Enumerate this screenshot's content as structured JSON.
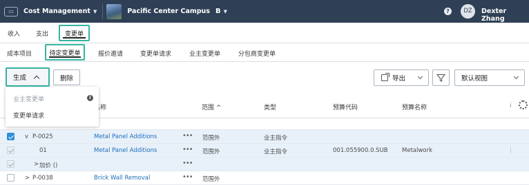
{
  "topbar": {
    "app_name": "Cost Management",
    "project_name": "Pacific Center Campus",
    "project_badge": "B",
    "help_label": "?",
    "user_initials": "DZ",
    "user_name": "Dexter Zhang"
  },
  "main_tabs": [
    {
      "label": "收入",
      "selected": false
    },
    {
      "label": "支出",
      "selected": false
    },
    {
      "label": "变更单",
      "selected": true
    }
  ],
  "sub_tabs": [
    {
      "label": "成本项目",
      "selected": false
    },
    {
      "label": "待定变更单",
      "selected": true
    },
    {
      "label": "报价邀请",
      "selected": false
    },
    {
      "label": "变更单请求",
      "selected": false
    },
    {
      "label": "业主变更单",
      "selected": false
    },
    {
      "label": "分包商变更单",
      "selected": false
    }
  ],
  "toolbar": {
    "generate_label": "生成",
    "delete_label": "删除",
    "export_label": "导出",
    "view_label": "默认视图"
  },
  "generate_menu": {
    "items": [
      {
        "label": "业主变更单",
        "disabled": true,
        "icon": "info-icon"
      },
      {
        "label": "变更单请求",
        "disabled": false
      }
    ]
  },
  "table": {
    "headers": {
      "name_partial": "名称",
      "scope": "范围 ^",
      "type": "类型",
      "budget_code": "预算代码",
      "budget_name": "预算名称"
    },
    "rows": [
      {
        "checkbox": "checked",
        "expander": "v",
        "id": "P-0025",
        "name": "Metal Panel Additions",
        "scope": "范围外",
        "type": "业主指令",
        "budget_code": "",
        "budget_name": ""
      },
      {
        "checkbox": "disabled-checked",
        "expander": "",
        "id": "01",
        "name": "Metal Panel Additions",
        "scope": "范围外",
        "type": "业主指令",
        "budget_code": "001.055900.0.SUB",
        "budget_name": "Metalwork"
      },
      {
        "checkbox": "disabled-checked",
        "expander": ">",
        "id": "加价 ()",
        "name": "",
        "scope": "",
        "type": "",
        "budget_code": "",
        "budget_name": ""
      },
      {
        "checkbox": "unchecked",
        "expander": ">",
        "id": "P-0038",
        "name": "Brick Wall Removal",
        "scope": "范围外",
        "type": "",
        "budget_code": "",
        "budget_name": ""
      }
    ]
  },
  "colors": {
    "topbar_bg": "#2f3f55",
    "highlight": "#35b3a0",
    "link": "#1f6dbb",
    "checkbox_checked": "#2f8fd8",
    "selected_row_bg": "#e8f1fa"
  }
}
